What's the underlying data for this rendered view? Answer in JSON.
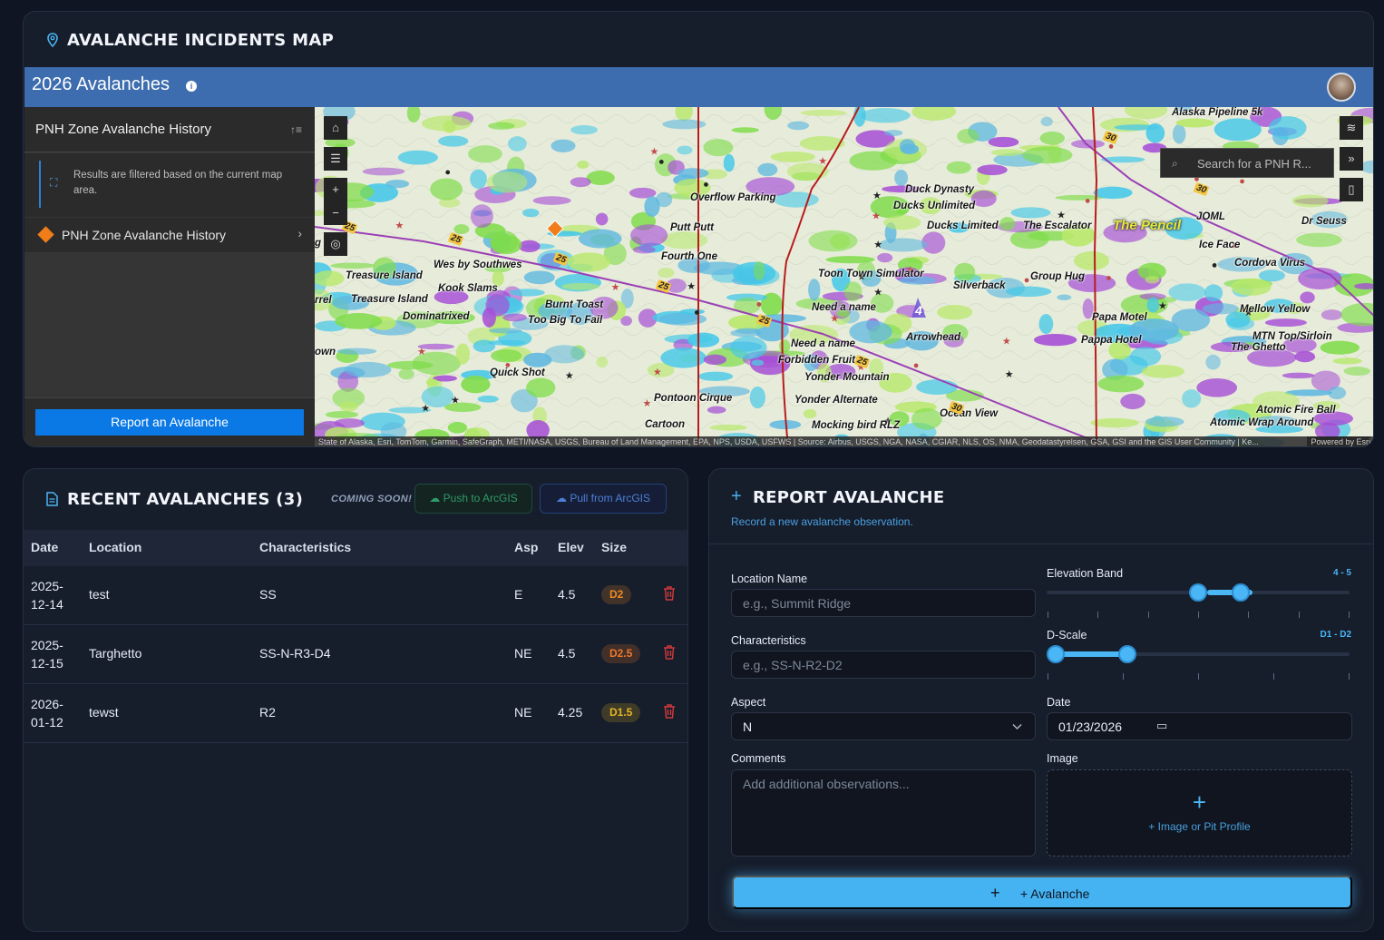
{
  "map_card": {
    "title": "AVALANCHE INCIDENTS MAP",
    "app_title": "2026 Avalanches",
    "side_panel": {
      "title": "PNH Zone Avalanche History",
      "filter_note": "Results are filtered based on the current map area.",
      "layer_label": "PNH Zone Avalanche History",
      "report_button": "Report an Avalanche"
    },
    "search_placeholder": "Search for a PNH R...",
    "attribution": "State of Alaska, Esri, TomTom, Garmin, SafeGraph, METI/NASA, USGS, Bureau of Land Management, EPA, NPS, USDA, USFWS | Source: Airbus, USGS, NGA, NASA, CGIAR, NLS, OS, NMA, Geodatastyrelsen, GSA, GSI and the GIS User Community | Ke...",
    "powered_by": "Powered by Esri",
    "cluster_count": "4",
    "highway_labels": [
      "25",
      "25",
      "25",
      "25",
      "25",
      "25",
      "30",
      "30",
      "30"
    ],
    "place_labels": [
      "Alaska Pipeline 5k",
      "Overflow Parking",
      "Duck Dynasty",
      "Ducks Unlimited",
      "Ducks Limited",
      "The Escalator",
      "The Pencil",
      "JOML",
      "Dr Seuss",
      "Ice Face",
      "Cordova Virus",
      "Putt Putt",
      "Fourth One",
      "Wes by Southwes",
      "Treasure Island",
      "Kook Slams",
      "Treasure Island",
      "Dominatrixed",
      "Burnt Toast",
      "Too Big To Fail",
      "Toon Town Simulator",
      "Group Hug",
      "Silverback",
      "Need a name",
      "Papa Motel",
      "Mellow Yellow",
      "Arrowhead",
      "Pappa Hotel",
      "Need a name",
      "MTN Top/Sirloin",
      "The Ghetto",
      "Forbidden Fruit",
      "Yonder Mountain",
      "Quick Shot",
      "Pontoon Cirque",
      "Yonder Alternate",
      "Ocean View",
      "Atomic Fire Ball",
      "Atomic Wrap Around",
      "Cartoon",
      "Mocking bird RLZ",
      "rrel",
      "own",
      "g R"
    ]
  },
  "recent": {
    "title": "RECENT AVALANCHES (3)",
    "coming_soon": "COMING SOON!",
    "push_label": "Push to ArcGIS",
    "pull_label": "Pull from ArcGIS",
    "columns": [
      "Date",
      "Location",
      "Characteristics",
      "Asp",
      "Elev",
      "Size"
    ],
    "rows": [
      {
        "date_a": "2025-",
        "date_b": "12-14",
        "location": "test",
        "characteristics": "SS",
        "aspect": "E",
        "elev": "4.5",
        "size": "D2"
      },
      {
        "date_a": "2025-",
        "date_b": "12-15",
        "location": "Targhetto",
        "characteristics": "SS-N-R3-D4",
        "aspect": "NE",
        "elev": "4.5",
        "size": "D2.5"
      },
      {
        "date_a": "2026-",
        "date_b": "01-12",
        "location": "tewst",
        "characteristics": "R2",
        "aspect": "NE",
        "elev": "4.25",
        "size": "D1.5"
      }
    ],
    "size_colors": {
      "D2": "#f08a24",
      "D2.5": "#f0782a",
      "D1.5": "#e3b623"
    }
  },
  "report": {
    "title": "REPORT AVALANCHE",
    "subtitle": "Record a new avalanche observation.",
    "location_label": "Location Name",
    "location_placeholder": "e.g., Summit Ridge",
    "characteristics_label": "Characteristics",
    "characteristics_placeholder": "e.g., SS-N-R2-D2",
    "aspect_label": "Aspect",
    "aspect_value": "N",
    "comments_label": "Comments",
    "comments_placeholder": "Add additional observations...",
    "elevation_label": "Elevation Band",
    "elevation_range": "4 - 5",
    "elevation_fraction": [
      0.5,
      0.65
    ],
    "dscale_label": "D-Scale",
    "dscale_range": "D1 - D2",
    "dscale_fraction": [
      0.0,
      0.25
    ],
    "date_label": "Date",
    "date_value": "01/23/2026",
    "image_label": "Image",
    "image_text": "+ Image or Pit Profile",
    "submit_label": "+ Avalanche"
  },
  "colors": {
    "accent": "#4ab6f5",
    "brand_header": "#3d6dae",
    "report_button": "#0a79e6"
  }
}
